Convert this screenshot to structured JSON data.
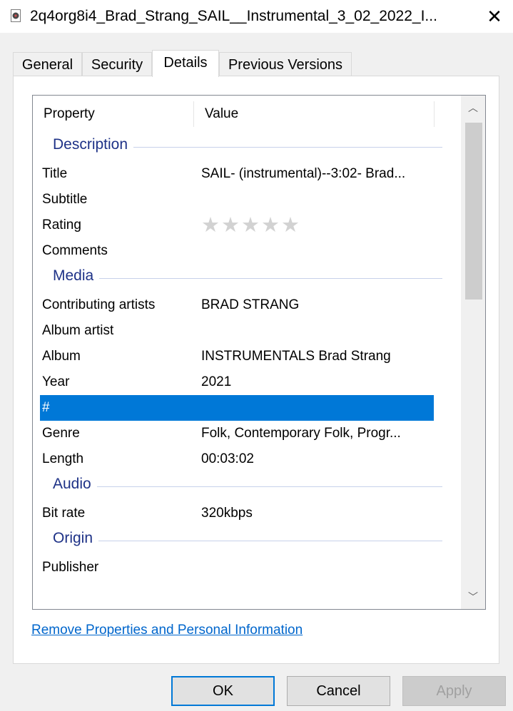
{
  "window": {
    "title": "2q4org8i4_Brad_Strang_SAIL__Instrumental_3_02_2022_I...",
    "close_glyph": "✕"
  },
  "tabs": [
    {
      "label": "General"
    },
    {
      "label": "Security"
    },
    {
      "label": "Details"
    },
    {
      "label": "Previous Versions"
    }
  ],
  "list": {
    "header": {
      "property": "Property",
      "value": "Value"
    },
    "groups": {
      "description": "Description",
      "media": "Media",
      "audio": "Audio",
      "origin": "Origin"
    },
    "rows": {
      "title": {
        "label": "Title",
        "value": "SAIL- (instrumental)--3:02- Brad..."
      },
      "subtitle": {
        "label": "Subtitle",
        "value": ""
      },
      "rating": {
        "label": "Rating",
        "stars": 0,
        "max": 5
      },
      "comments": {
        "label": "Comments",
        "value": ""
      },
      "contributing_artists": {
        "label": "Contributing artists",
        "value": "BRAD STRANG"
      },
      "album_artist": {
        "label": "Album artist",
        "value": ""
      },
      "album": {
        "label": "Album",
        "value": "INSTRUMENTALS Brad Strang"
      },
      "year": {
        "label": "Year",
        "value": "2021"
      },
      "track": {
        "label": "#",
        "value": ""
      },
      "genre": {
        "label": "Genre",
        "value": "Folk, Contemporary Folk, Progr..."
      },
      "length": {
        "label": "Length",
        "value": "00:03:02"
      },
      "bit_rate": {
        "label": "Bit rate",
        "value": "320kbps"
      },
      "publisher": {
        "label": "Publisher",
        "value": ""
      }
    }
  },
  "scrollbar": {
    "up_glyph": "︿",
    "down_glyph": "﹀"
  },
  "link": {
    "label": "Remove Properties and Personal Information"
  },
  "buttons": {
    "ok": "OK",
    "cancel": "Cancel",
    "apply": "Apply"
  },
  "colors": {
    "selection": "#0078d7",
    "group_header": "#1e3287",
    "link": "#0066cc"
  }
}
